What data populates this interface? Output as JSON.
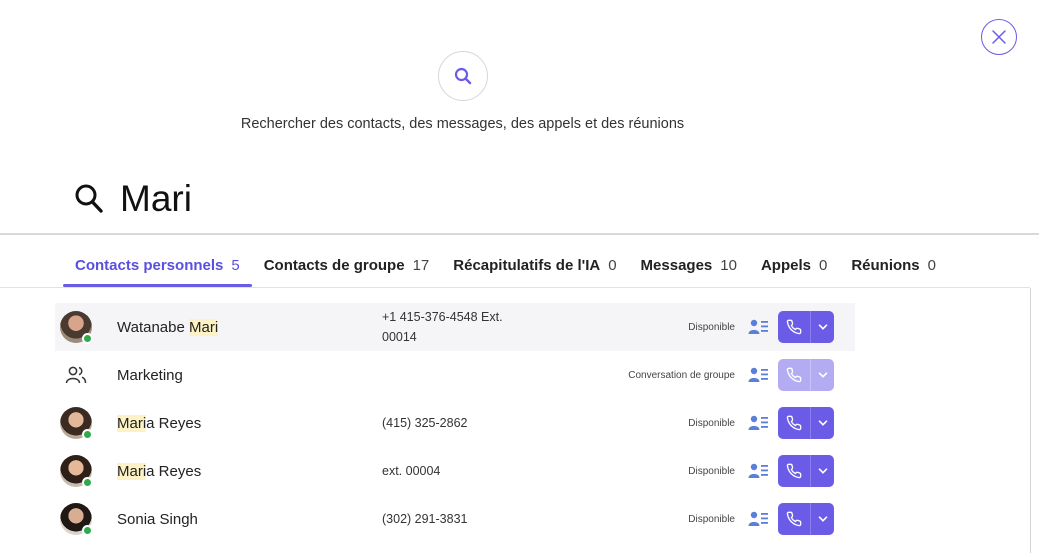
{
  "hero": {
    "icon": "search-icon",
    "text": "Rechercher des contacts, des messages, des appels et des réunions"
  },
  "search": {
    "value": "Mari",
    "icon": "search-icon"
  },
  "close": {
    "icon": "close-icon"
  },
  "tabs": [
    {
      "label": "Contacts personnels",
      "count": "5",
      "active": true
    },
    {
      "label": "Contacts de groupe",
      "count": "17"
    },
    {
      "label": "Récapitulatifs de l'IA",
      "count": "0"
    },
    {
      "label": "Messages",
      "count": "10"
    },
    {
      "label": "Appels",
      "count": "0"
    },
    {
      "label": "Réunions",
      "count": "0"
    }
  ],
  "results": [
    {
      "name_pre": "Watanabe ",
      "name_match": "Mari",
      "name_post": "",
      "phone": "+1 415-376-4548 Ext. 00014",
      "status": "Disponible",
      "avatar": "avatar-photo",
      "presence": "available"
    },
    {
      "name_pre": "Marketing",
      "name_match": "",
      "name_post": "",
      "phone": "",
      "status": "Conversation de groupe",
      "avatar": "group-icon"
    },
    {
      "name_pre": "",
      "name_match": "Mari",
      "name_post": "a Reyes",
      "phone": "(415) 325-2862",
      "status": "Disponible",
      "avatar": "avatar-photo",
      "presence": "available"
    },
    {
      "name_pre": "",
      "name_match": "Mari",
      "name_post": "a Reyes",
      "phone": "ext. 00004",
      "status": "Disponible",
      "avatar": "avatar-photo",
      "presence": "available"
    },
    {
      "name_pre": "Sonia Singh",
      "name_match": "",
      "name_post": "",
      "phone": "(302) 291-3831",
      "status": "Disponible",
      "avatar": "avatar-photo",
      "presence": "available"
    }
  ],
  "colors": {
    "accent": "#6b5ce7",
    "presence": "#2eaa4b",
    "highlight": "#fdf2c4"
  }
}
